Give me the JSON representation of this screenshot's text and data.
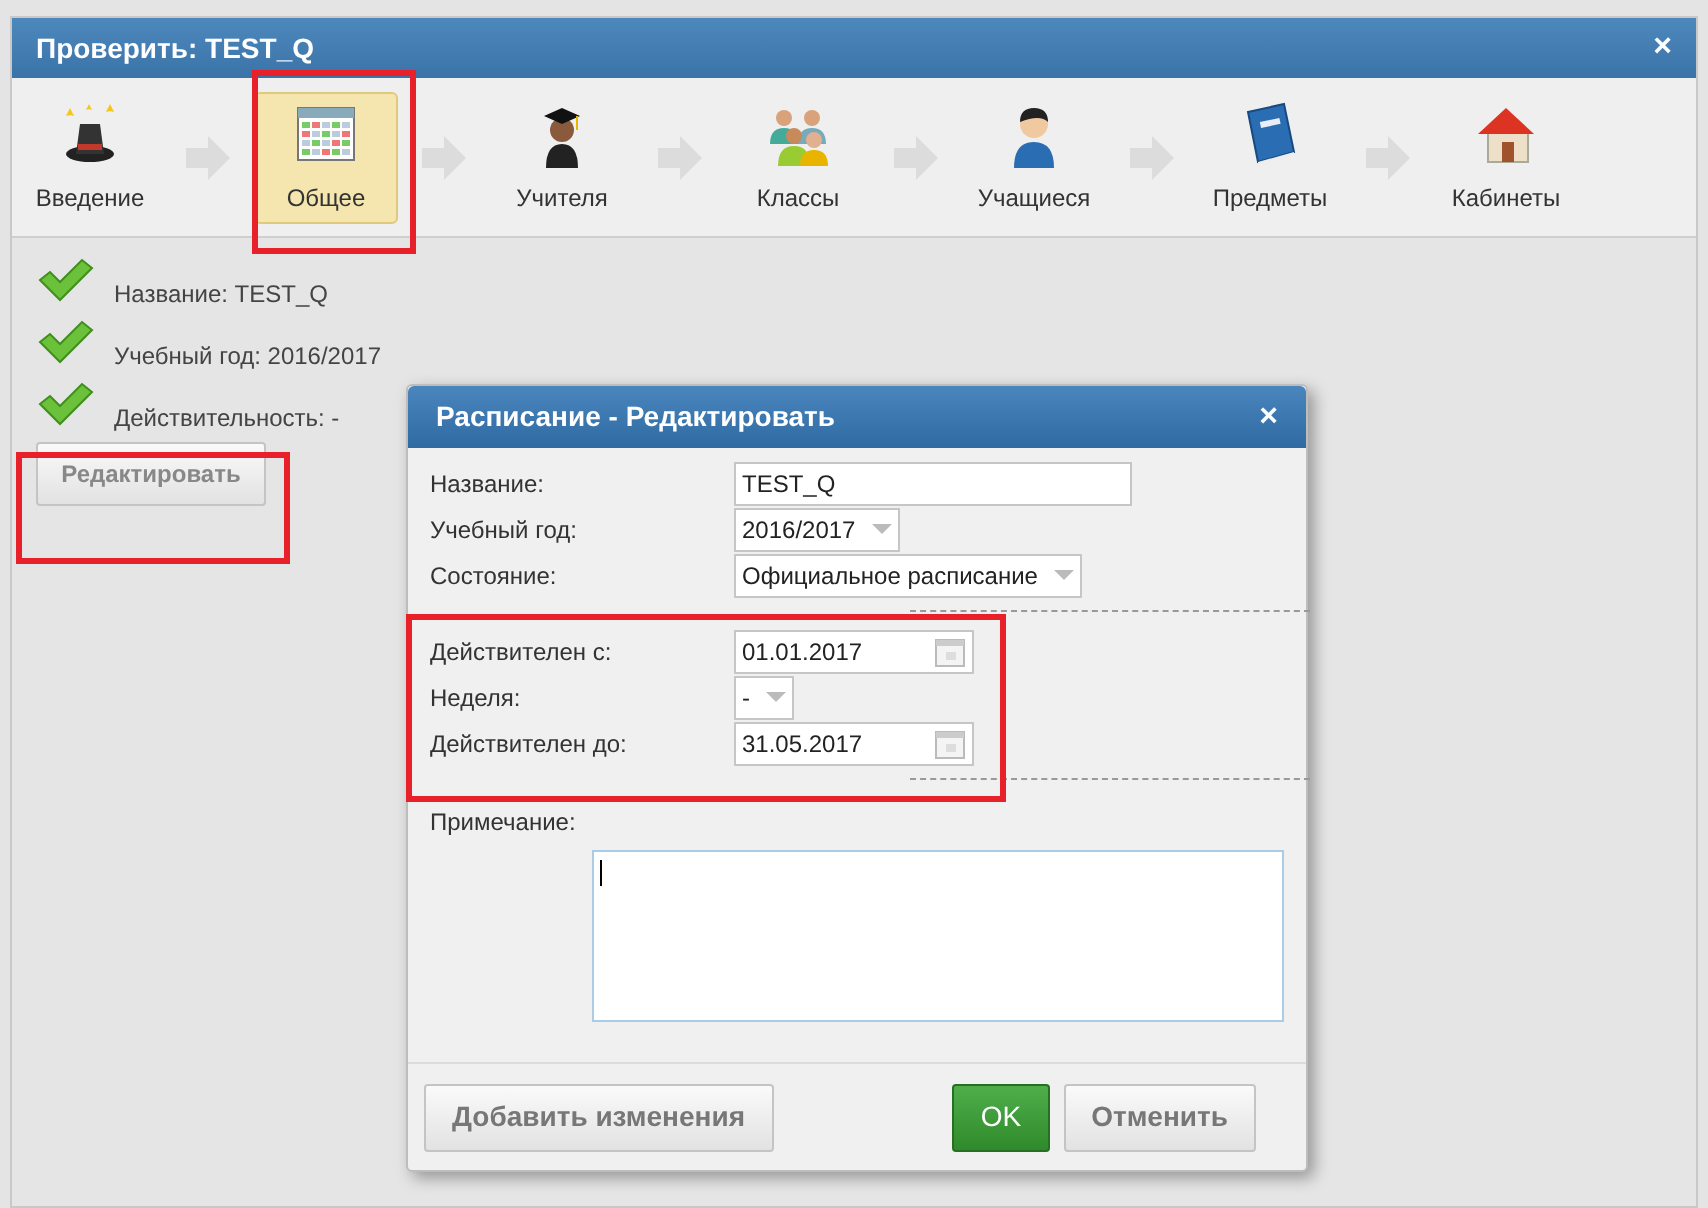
{
  "window": {
    "title": "Проверить: TEST_Q",
    "close": "×"
  },
  "steps": [
    {
      "label": "Введение",
      "kind": "magic",
      "selected": false
    },
    {
      "label": "Общее",
      "kind": "calendar",
      "selected": true
    },
    {
      "label": "Учителя",
      "kind": "teacher",
      "selected": false
    },
    {
      "label": "Классы",
      "kind": "group",
      "selected": false
    },
    {
      "label": "Учащиеся",
      "kind": "student",
      "selected": false
    },
    {
      "label": "Предметы",
      "kind": "book",
      "selected": false
    },
    {
      "label": "Кабинеты",
      "kind": "house",
      "selected": false
    }
  ],
  "summary": [
    "Название: TEST_Q",
    "Учебный год: 2016/2017",
    "Действительность: -"
  ],
  "edit_button": "Редактировать",
  "dialog": {
    "title": "Расписание - Редактировать",
    "close": "×",
    "fields": [
      {
        "label": "Название:",
        "kind": "text",
        "value": "TEST_Q"
      },
      {
        "label": "Учебный год:",
        "kind": "select",
        "value": "2016/2017"
      },
      {
        "label": "Состояние:",
        "kind": "select",
        "value": "Официальное расписание"
      }
    ],
    "validity_fields": [
      {
        "label": "Действителен с:",
        "kind": "date",
        "value": "01.01.2017"
      },
      {
        "label": "Неделя:",
        "kind": "select",
        "value": "-"
      },
      {
        "label": "Действителен до:",
        "kind": "date",
        "value": "31.05.2017"
      }
    ],
    "note": {
      "label": "Примечание:"
    },
    "buttons": [
      {
        "label": "Добавить изменения",
        "kind": "default"
      },
      {
        "label": "OK",
        "kind": "primary"
      },
      {
        "label": "Отменить",
        "kind": "default"
      }
    ]
  }
}
